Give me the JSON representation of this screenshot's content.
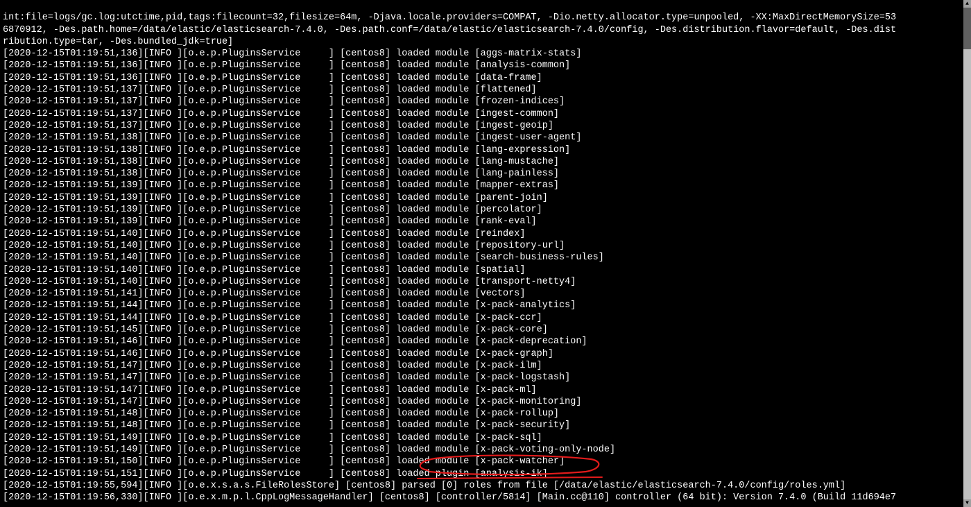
{
  "header_wrap": {
    "line1": "int:file=logs/gc.log:utctime,pid,tags:filecount=32,filesize=64m, -Djava.locale.providers=COMPAT, -Dio.netty.allocator.type=unpooled, -XX:MaxDirectMemorySize=53",
    "line2": "6870912, -Des.path.home=/data/elastic/elasticsearch-7.4.0, -Des.path.conf=/data/elastic/elasticsearch-7.4.0/config, -Des.distribution.flavor=default, -Des.dist",
    "line3": "ribution.type=tar, -Des.bundled_jdk=true]"
  },
  "log_lines": [
    {
      "ts": "2020-12-15T01:19:51,136",
      "lvl": "INFO",
      "src": "o.e.p.PluginsService",
      "pad": "     ",
      "node": "centos8",
      "msg": "loaded module [aggs-matrix-stats]"
    },
    {
      "ts": "2020-12-15T01:19:51,136",
      "lvl": "INFO",
      "src": "o.e.p.PluginsService",
      "pad": "     ",
      "node": "centos8",
      "msg": "loaded module [analysis-common]"
    },
    {
      "ts": "2020-12-15T01:19:51,136",
      "lvl": "INFO",
      "src": "o.e.p.PluginsService",
      "pad": "     ",
      "node": "centos8",
      "msg": "loaded module [data-frame]"
    },
    {
      "ts": "2020-12-15T01:19:51,137",
      "lvl": "INFO",
      "src": "o.e.p.PluginsService",
      "pad": "     ",
      "node": "centos8",
      "msg": "loaded module [flattened]"
    },
    {
      "ts": "2020-12-15T01:19:51,137",
      "lvl": "INFO",
      "src": "o.e.p.PluginsService",
      "pad": "     ",
      "node": "centos8",
      "msg": "loaded module [frozen-indices]"
    },
    {
      "ts": "2020-12-15T01:19:51,137",
      "lvl": "INFO",
      "src": "o.e.p.PluginsService",
      "pad": "     ",
      "node": "centos8",
      "msg": "loaded module [ingest-common]"
    },
    {
      "ts": "2020-12-15T01:19:51,137",
      "lvl": "INFO",
      "src": "o.e.p.PluginsService",
      "pad": "     ",
      "node": "centos8",
      "msg": "loaded module [ingest-geoip]"
    },
    {
      "ts": "2020-12-15T01:19:51,138",
      "lvl": "INFO",
      "src": "o.e.p.PluginsService",
      "pad": "     ",
      "node": "centos8",
      "msg": "loaded module [ingest-user-agent]"
    },
    {
      "ts": "2020-12-15T01:19:51,138",
      "lvl": "INFO",
      "src": "o.e.p.PluginsService",
      "pad": "     ",
      "node": "centos8",
      "msg": "loaded module [lang-expression]"
    },
    {
      "ts": "2020-12-15T01:19:51,138",
      "lvl": "INFO",
      "src": "o.e.p.PluginsService",
      "pad": "     ",
      "node": "centos8",
      "msg": "loaded module [lang-mustache]"
    },
    {
      "ts": "2020-12-15T01:19:51,138",
      "lvl": "INFO",
      "src": "o.e.p.PluginsService",
      "pad": "     ",
      "node": "centos8",
      "msg": "loaded module [lang-painless]"
    },
    {
      "ts": "2020-12-15T01:19:51,139",
      "lvl": "INFO",
      "src": "o.e.p.PluginsService",
      "pad": "     ",
      "node": "centos8",
      "msg": "loaded module [mapper-extras]"
    },
    {
      "ts": "2020-12-15T01:19:51,139",
      "lvl": "INFO",
      "src": "o.e.p.PluginsService",
      "pad": "     ",
      "node": "centos8",
      "msg": "loaded module [parent-join]"
    },
    {
      "ts": "2020-12-15T01:19:51,139",
      "lvl": "INFO",
      "src": "o.e.p.PluginsService",
      "pad": "     ",
      "node": "centos8",
      "msg": "loaded module [percolator]"
    },
    {
      "ts": "2020-12-15T01:19:51,139",
      "lvl": "INFO",
      "src": "o.e.p.PluginsService",
      "pad": "     ",
      "node": "centos8",
      "msg": "loaded module [rank-eval]"
    },
    {
      "ts": "2020-12-15T01:19:51,140",
      "lvl": "INFO",
      "src": "o.e.p.PluginsService",
      "pad": "     ",
      "node": "centos8",
      "msg": "loaded module [reindex]"
    },
    {
      "ts": "2020-12-15T01:19:51,140",
      "lvl": "INFO",
      "src": "o.e.p.PluginsService",
      "pad": "     ",
      "node": "centos8",
      "msg": "loaded module [repository-url]"
    },
    {
      "ts": "2020-12-15T01:19:51,140",
      "lvl": "INFO",
      "src": "o.e.p.PluginsService",
      "pad": "     ",
      "node": "centos8",
      "msg": "loaded module [search-business-rules]"
    },
    {
      "ts": "2020-12-15T01:19:51,140",
      "lvl": "INFO",
      "src": "o.e.p.PluginsService",
      "pad": "     ",
      "node": "centos8",
      "msg": "loaded module [spatial]"
    },
    {
      "ts": "2020-12-15T01:19:51,140",
      "lvl": "INFO",
      "src": "o.e.p.PluginsService",
      "pad": "     ",
      "node": "centos8",
      "msg": "loaded module [transport-netty4]"
    },
    {
      "ts": "2020-12-15T01:19:51,141",
      "lvl": "INFO",
      "src": "o.e.p.PluginsService",
      "pad": "     ",
      "node": "centos8",
      "msg": "loaded module [vectors]"
    },
    {
      "ts": "2020-12-15T01:19:51,144",
      "lvl": "INFO",
      "src": "o.e.p.PluginsService",
      "pad": "     ",
      "node": "centos8",
      "msg": "loaded module [x-pack-analytics]"
    },
    {
      "ts": "2020-12-15T01:19:51,144",
      "lvl": "INFO",
      "src": "o.e.p.PluginsService",
      "pad": "     ",
      "node": "centos8",
      "msg": "loaded module [x-pack-ccr]"
    },
    {
      "ts": "2020-12-15T01:19:51,145",
      "lvl": "INFO",
      "src": "o.e.p.PluginsService",
      "pad": "     ",
      "node": "centos8",
      "msg": "loaded module [x-pack-core]"
    },
    {
      "ts": "2020-12-15T01:19:51,146",
      "lvl": "INFO",
      "src": "o.e.p.PluginsService",
      "pad": "     ",
      "node": "centos8",
      "msg": "loaded module [x-pack-deprecation]"
    },
    {
      "ts": "2020-12-15T01:19:51,146",
      "lvl": "INFO",
      "src": "o.e.p.PluginsService",
      "pad": "     ",
      "node": "centos8",
      "msg": "loaded module [x-pack-graph]"
    },
    {
      "ts": "2020-12-15T01:19:51,147",
      "lvl": "INFO",
      "src": "o.e.p.PluginsService",
      "pad": "     ",
      "node": "centos8",
      "msg": "loaded module [x-pack-ilm]"
    },
    {
      "ts": "2020-12-15T01:19:51,147",
      "lvl": "INFO",
      "src": "o.e.p.PluginsService",
      "pad": "     ",
      "node": "centos8",
      "msg": "loaded module [x-pack-logstash]"
    },
    {
      "ts": "2020-12-15T01:19:51,147",
      "lvl": "INFO",
      "src": "o.e.p.PluginsService",
      "pad": "     ",
      "node": "centos8",
      "msg": "loaded module [x-pack-ml]"
    },
    {
      "ts": "2020-12-15T01:19:51,147",
      "lvl": "INFO",
      "src": "o.e.p.PluginsService",
      "pad": "     ",
      "node": "centos8",
      "msg": "loaded module [x-pack-monitoring]"
    },
    {
      "ts": "2020-12-15T01:19:51,148",
      "lvl": "INFO",
      "src": "o.e.p.PluginsService",
      "pad": "     ",
      "node": "centos8",
      "msg": "loaded module [x-pack-rollup]"
    },
    {
      "ts": "2020-12-15T01:19:51,148",
      "lvl": "INFO",
      "src": "o.e.p.PluginsService",
      "pad": "     ",
      "node": "centos8",
      "msg": "loaded module [x-pack-security]"
    },
    {
      "ts": "2020-12-15T01:19:51,149",
      "lvl": "INFO",
      "src": "o.e.p.PluginsService",
      "pad": "     ",
      "node": "centos8",
      "msg": "loaded module [x-pack-sql]"
    },
    {
      "ts": "2020-12-15T01:19:51,149",
      "lvl": "INFO",
      "src": "o.e.p.PluginsService",
      "pad": "     ",
      "node": "centos8",
      "msg": "loaded module [x-pack-voting-only-node]"
    },
    {
      "ts": "2020-12-15T01:19:51,150",
      "lvl": "INFO",
      "src": "o.e.p.PluginsService",
      "pad": "     ",
      "node": "centos8",
      "msg": "loaded module [x-pack-watcher]"
    },
    {
      "ts": "2020-12-15T01:19:51,151",
      "lvl": "INFO",
      "src": "o.e.p.PluginsService",
      "pad": "     ",
      "node": "centos8",
      "msg": "loaded plugin [analysis-ik]"
    },
    {
      "ts": "2020-12-15T01:19:55,594",
      "lvl": "INFO",
      "src": "o.e.x.s.a.s.FileRolesStore",
      "pad": "",
      "node": "centos8",
      "msg": "parsed [0] roles from file [/data/elastic/elasticsearch-7.4.0/config/roles.yml]"
    },
    {
      "ts": "2020-12-15T01:19:56,330",
      "lvl": "INFO",
      "src": "o.e.x.m.p.l.CppLogMessageHandler",
      "pad": "",
      "node": "centos8",
      "msg": "[controller/5814] [Main.cc@110] controller (64 bit): Version 7.4.0 (Build 11d694e7"
    }
  ],
  "annotation": {
    "circle_style": "left:597px; top:656px; width:270px; height:30px;",
    "strike_style": "left:602px; top:682px; width:266px; height:16px;"
  },
  "scrollbar": {
    "thumb_style": "top:11px; height:60px;",
    "up_glyph": "▲",
    "down_glyph": "▼"
  }
}
